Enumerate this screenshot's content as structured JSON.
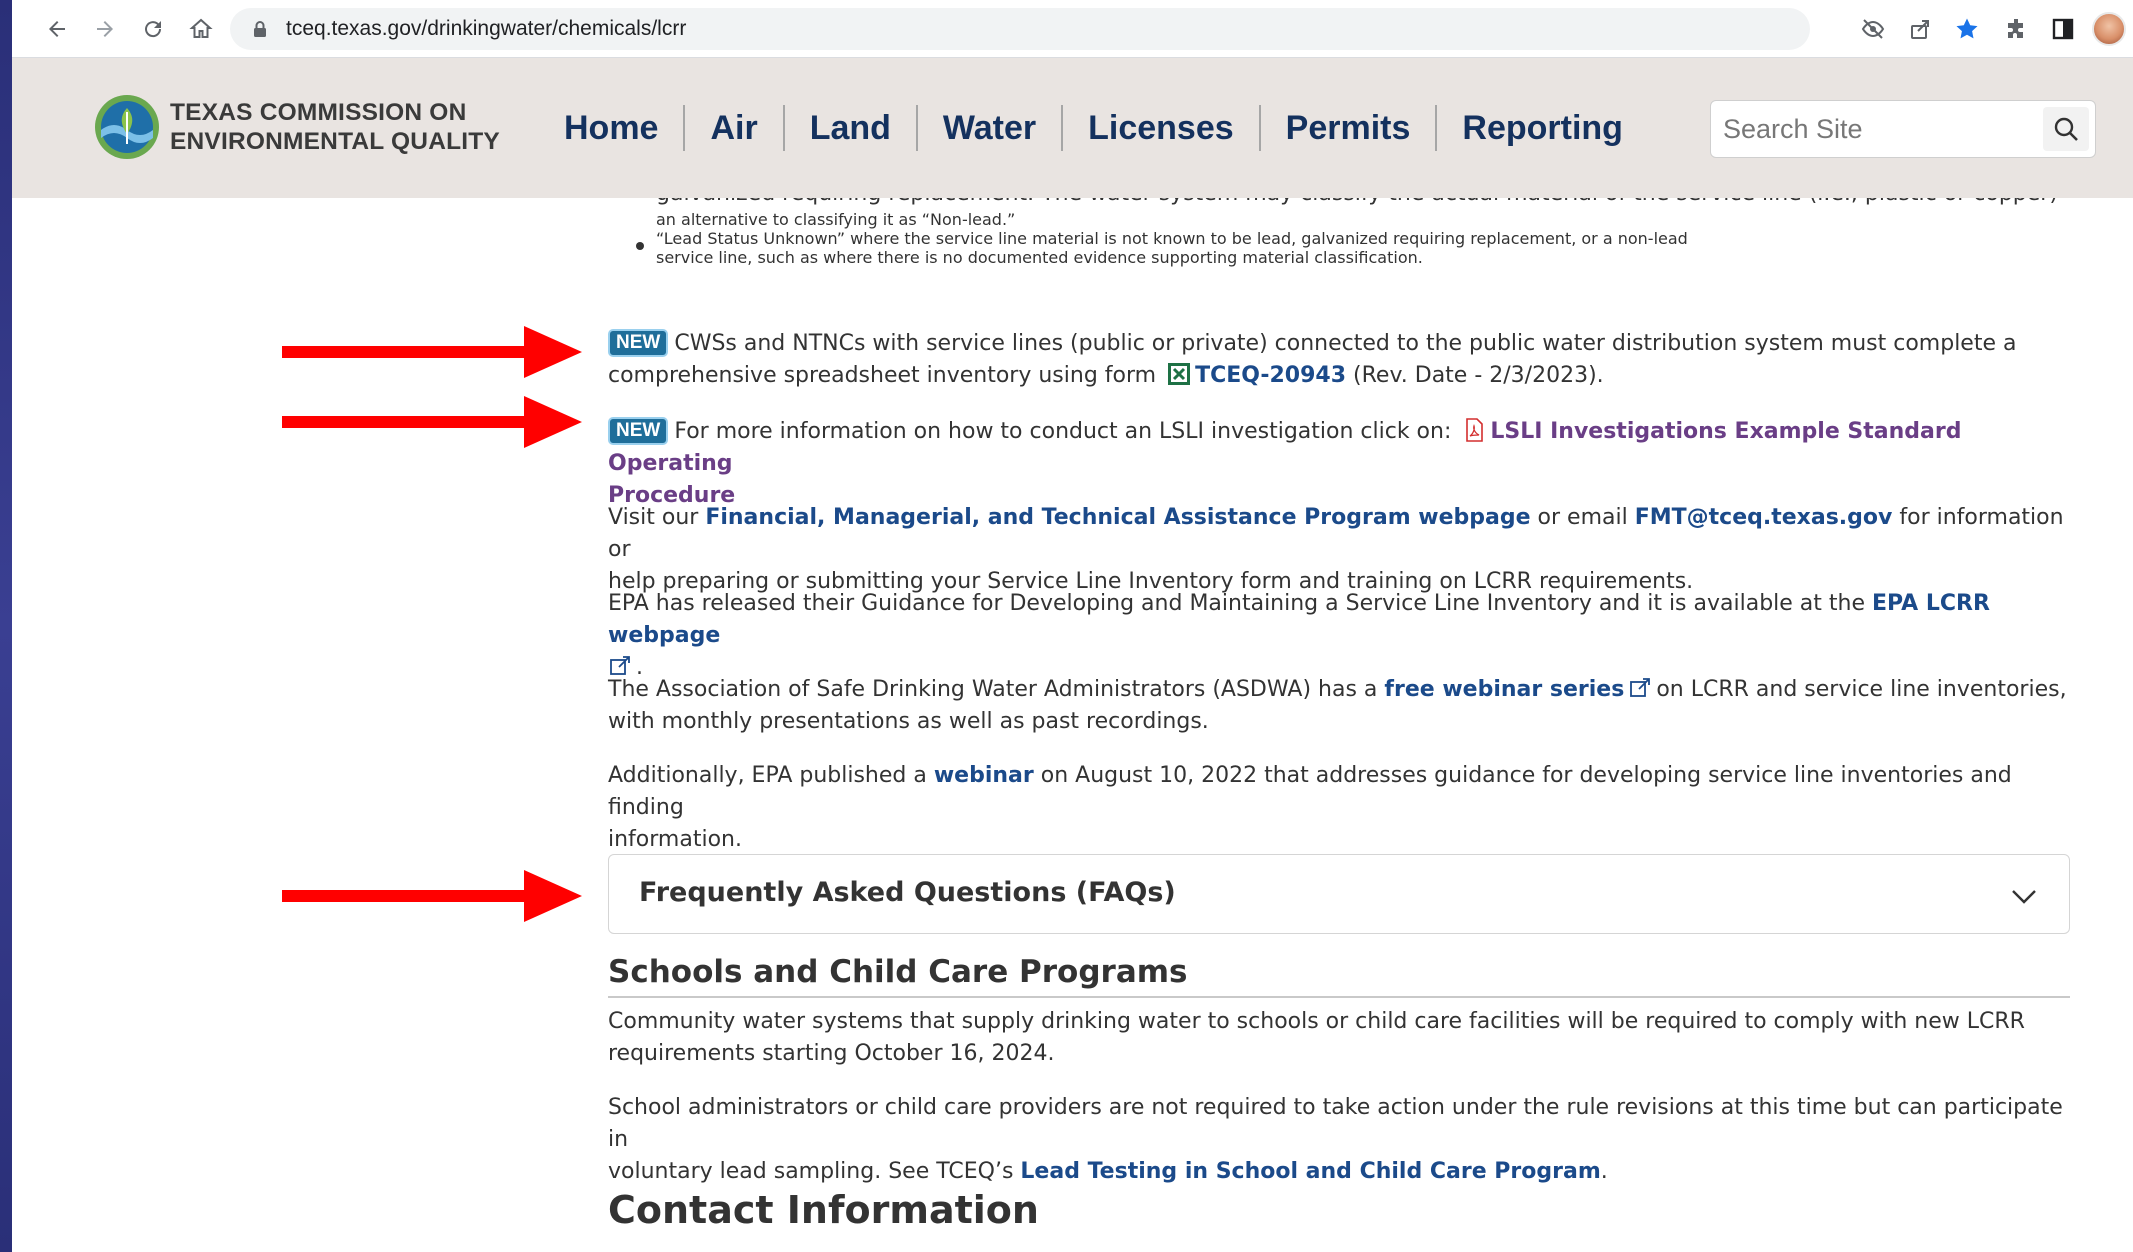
{
  "browser": {
    "url": "tceq.texas.gov/drinkingwater/chemicals/lcrr"
  },
  "site": {
    "logo_line1": "TEXAS COMMISSION ON",
    "logo_line2": "ENVIRONMENTAL QUALITY",
    "nav": [
      "Home",
      "Air",
      "Land",
      "Water",
      "Licenses",
      "Permits",
      "Reporting"
    ],
    "search_placeholder": "Search Site"
  },
  "content": {
    "cut_line": "galvanized requiring replacement. The water system may classify the actual material of the service line (i.e., plastic or copper) as",
    "bullet1_cont": "an alternative to classifying it as “Non-lead.”",
    "bullet2_line1": "“Lead Status Unknown” where the service line material is not known to be lead, galvanized requiring replacement, or a non-lead",
    "bullet2_line2": "service line, such as where there is no documented evidence supporting material classification.",
    "badge": "NEW",
    "p1_text1": "CWSs and NTNCs with service lines (public or private) connected to the public water distribution system must complete a",
    "p1_text2": "comprehensive spreadsheet inventory using form",
    "p1_link": "TCEQ-20943",
    "p1_text3": "(Rev. Date - 2/3/2023).",
    "p2_text1": "For more information on how to conduct an LSLI investigation click on:",
    "p2_link_line1": "LSLI Investigations Example Standard Operating",
    "p2_link_line2": "Procedure",
    "p3_text1": "Visit our",
    "p3_link1": "Financial, Managerial, and Technical Assistance Program webpage",
    "p3_text2": "or email",
    "p3_link2": "FMT@tceq.texas.gov",
    "p3_text3": "for information or",
    "p3_text4": "help preparing or submitting your Service Line Inventory form and training on LCRR requirements.",
    "p4_text1": "EPA has released their Guidance for Developing and Maintaining a Service Line Inventory and it is available at the",
    "p4_link": "EPA LCRR webpage",
    "p4_text2": ".",
    "p5_text1": "The Association of Safe Drinking Water Administrators (ASDWA) has a",
    "p5_link": "free webinar series",
    "p5_text2": "on LCRR and service line inventories,",
    "p5_text3": "with monthly presentations as well as past recordings.",
    "p6_text1": "Additionally, EPA published a",
    "p6_link": "webinar",
    "p6_text2": "on August 10, 2022 that addresses guidance for developing service line inventories and finding",
    "p6_text3": "information.",
    "faq_title": "Frequently Asked Questions (FAQs)",
    "schools_title": "Schools and Child Care Programs",
    "s1_line1": "Community water systems that supply drinking water to schools or child care facilities will be required to comply with new LCRR",
    "s1_line2": "requirements starting October 16, 2024.",
    "s2_line1": "School administrators or child care providers are not required to take action under the rule revisions at this time but can participate in",
    "s2_text1": "voluntary lead sampling. See TCEQ’s",
    "s2_link": "Lead Testing in School and Child Care Program",
    "s2_text2": ".",
    "contact_title": "Contact Information"
  },
  "colors": {
    "annotation_arrow": "#ff0000",
    "nav_text": "#14315e",
    "link": "#1b4a8a",
    "visited_link": "#6a3e86",
    "header_bg": "#e9e4e1"
  }
}
